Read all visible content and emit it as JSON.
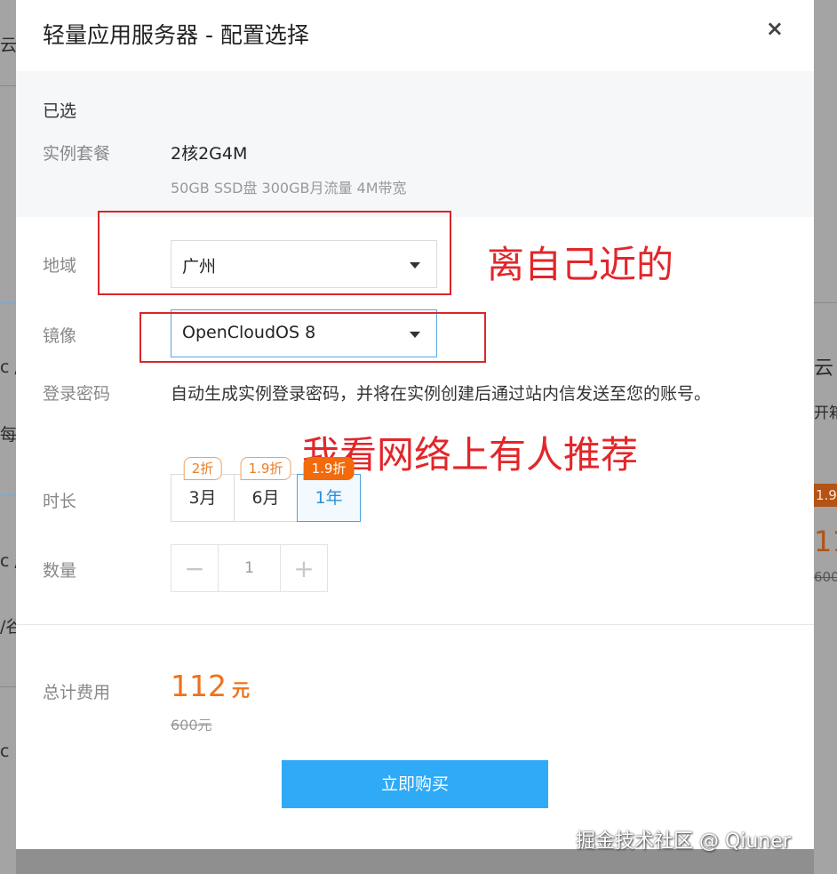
{
  "background": {
    "left_fragments": [
      "云",
      "c /",
      "每",
      "c /",
      "/谷",
      "c"
    ],
    "right_fragments": [
      "云",
      "开箱",
      "1.9",
      "11",
      "600"
    ]
  },
  "modal": {
    "title": "轻量应用服务器 - 配置选择",
    "close_label": "×",
    "selected": {
      "heading": "已选",
      "plan_label": "实例套餐",
      "plan_value": "2核2G4M",
      "plan_detail": "50GB SSD盘 300GB月流量 4M带宽"
    },
    "region": {
      "label": "地域",
      "value": "广州"
    },
    "image": {
      "label": "镜像",
      "value": "OpenCloudOS 8"
    },
    "password": {
      "label": "登录密码",
      "text": "自动生成实例登录密码，并将在实例创建后通过站内信发送至您的账号。"
    },
    "duration": {
      "label": "时长",
      "options": [
        {
          "label": "3月",
          "tag": "2折"
        },
        {
          "label": "6月",
          "tag": "1.9折"
        },
        {
          "label": "1年",
          "tag": "1.9折"
        }
      ],
      "selected_index": 2
    },
    "quantity": {
      "label": "数量",
      "value": "1",
      "minus": "−",
      "plus": "+"
    },
    "total": {
      "label": "总计费用",
      "price": "112",
      "unit": "元",
      "original": "600元"
    },
    "buy_label": "立即购买"
  },
  "annotations": {
    "note_region": "离自己近的",
    "note_image": "我看网络上有人推荐"
  },
  "watermark": "掘金技术社区 @ Qiuner",
  "colors": {
    "accent_blue": "#2eaaf7",
    "price_orange": "#f0711a",
    "annotation_red": "#d8262a"
  }
}
